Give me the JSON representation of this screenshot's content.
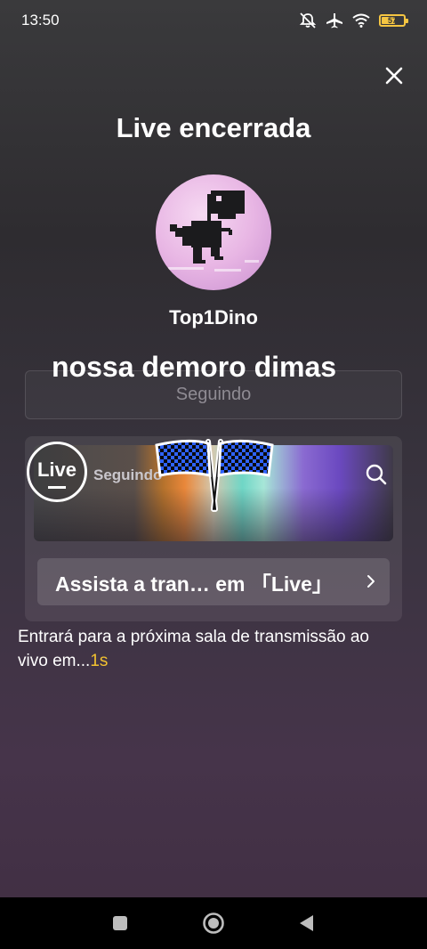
{
  "status_bar": {
    "time": "13:50",
    "battery_level": "57"
  },
  "icons": [
    "mute-icon",
    "airplane-icon",
    "wifi-icon",
    "battery-icon",
    "close-icon",
    "search-icon",
    "chevron-right-icon",
    "checkered-flags-icon",
    "dino-avatar",
    "nav-square-icon",
    "nav-home-icon",
    "nav-back-icon"
  ],
  "colors": {
    "accent_countdown": "#f2c230",
    "battery": "#f5c542"
  },
  "page": {
    "title": "Live encerrada",
    "username": "Top1Dino",
    "caption": "nossa demoro dimas",
    "follow_label": "Seguindo"
  },
  "live_card": {
    "logo_label": "Live",
    "tab_label": "Seguindo",
    "watch_label": "Assista a tran… em 「Live」"
  },
  "countdown": {
    "text": "Entrará para a próxima sala de transmissão ao vivo em...",
    "seconds": "1s"
  }
}
